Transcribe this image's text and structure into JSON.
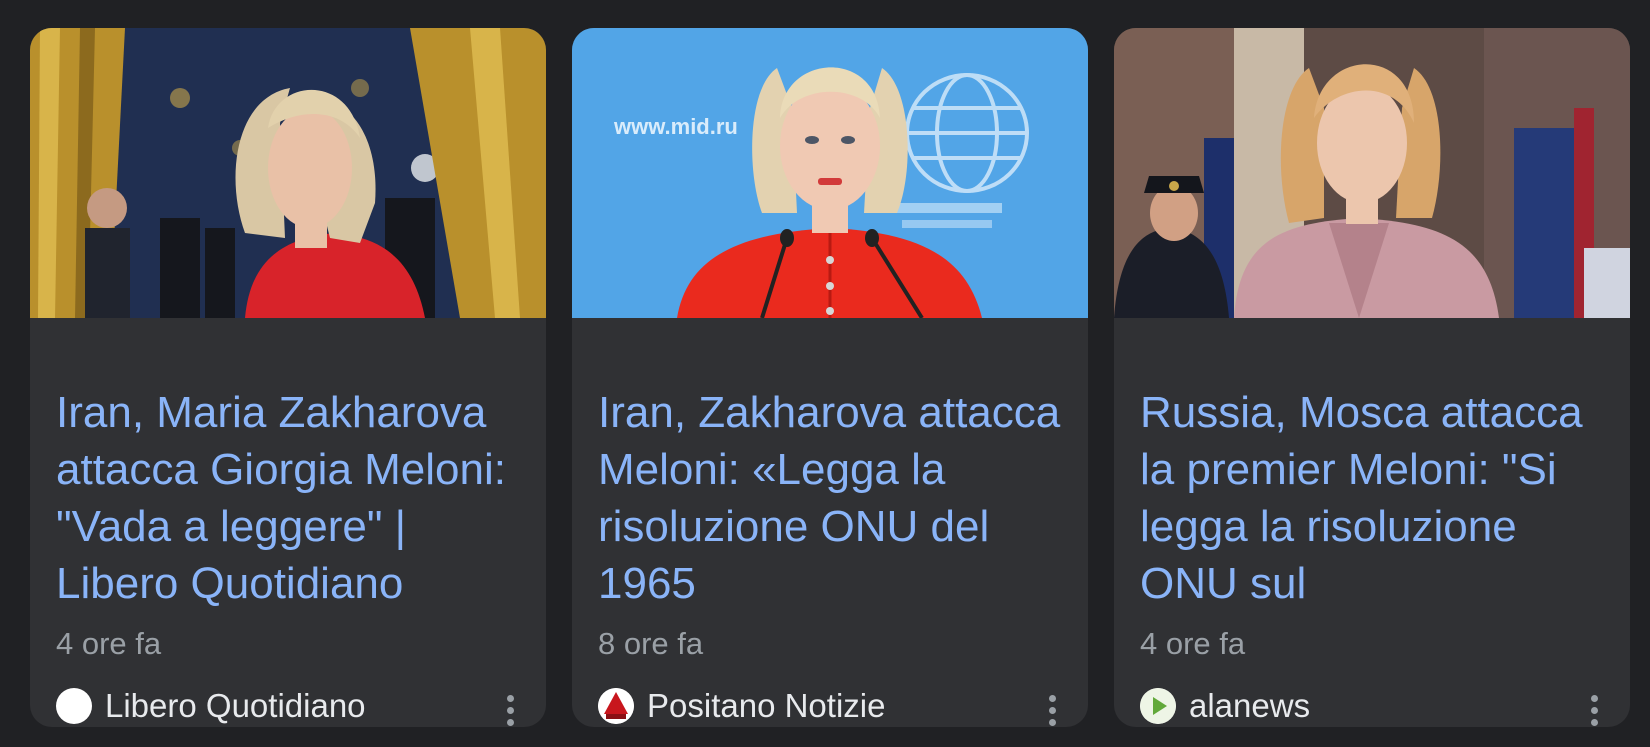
{
  "cards": [
    {
      "title": "Iran, Maria Zakharova attacca Giorgia Meloni: \"Vada a leggere\" | Libero Quotidiano",
      "time": "4 ore fa",
      "source": "Libero Quotidiano",
      "favicon_icon": "libero-favicon-icon",
      "image_icon": "woman-in-red-portrait-image"
    },
    {
      "title": "Iran, Zakharova attacca Meloni: «Legga la risoluzione ONU del 1965",
      "time": "8 ore fa",
      "source": "Positano Notizie",
      "favicon_icon": "positano-notizie-favicon-icon",
      "image_icon": "woman-at-podium-image",
      "image_text": "www.mid.ru"
    },
    {
      "title": "Russia, Mosca attacca la premier Meloni: \"Si legga la risoluzione ONU sul",
      "time": "4 ore fa",
      "source": "alanews",
      "favicon_icon": "alanews-play-favicon-icon",
      "image_icon": "woman-in-pink-suit-image"
    }
  ],
  "colors": {
    "background": "#202124",
    "card": "#303134",
    "title": "#8ab4f8",
    "meta": "#9aa0a6",
    "source": "#e8eaed"
  },
  "more_icon": "more-vert-icon"
}
